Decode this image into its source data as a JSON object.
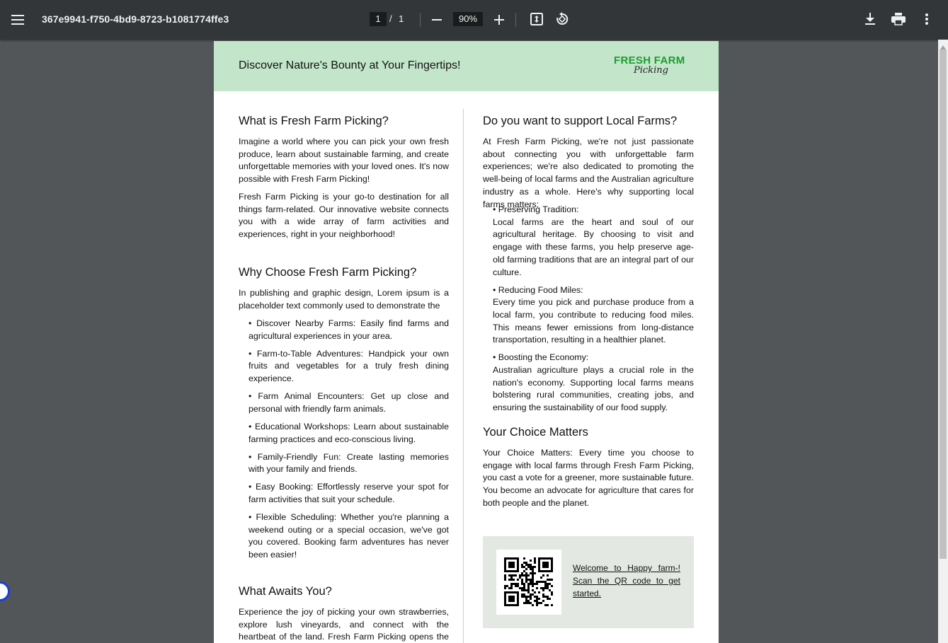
{
  "toolbar": {
    "doc_title": "367e9941-f750-4bd9-8723-b1081774ffe3",
    "current_page": "1",
    "page_separator": "/",
    "total_pages": "1",
    "zoom": "90%"
  },
  "page": {
    "banner": {
      "tagline": "Discover Nature's Bounty at Your Fingertips!",
      "logo_main": "FRESH FARM",
      "logo_script": "Picking"
    },
    "left": {
      "what_heading": "What is Fresh Farm Picking?",
      "what_p1": "Imagine a world where you can pick your own fresh produce, learn about sustainable farming, and create unforgettable memories with your loved ones. It's now possible with Fresh Farm Picking!",
      "what_p2": "Fresh Farm Picking is your go-to destination for all things farm-related. Our innovative website connects you with a wide array of farm activities and experiences, right in your neighborhood!",
      "why_heading": "Why Choose Fresh Farm Picking?",
      "why_intro": "In publishing and graphic design, Lorem ipsum is a placeholder text commonly used to demonstrate the",
      "bullets": [
        "• Discover Nearby Farms: Easily find farms and agricultural experiences in your area.",
        "• Farm-to-Table Adventures: Handpick your own fruits and vegetables for a truly fresh dining experience.",
        "• Farm Animal Encounters: Get up close and personal with friendly farm animals.",
        "• Educational Workshops: Learn about sustainable farming practices and eco-conscious living.",
        "• Family-Friendly Fun: Create lasting memories with your family and friends.",
        "• Easy Booking: Effortlessly reserve your spot for farm activities that suit your schedule.",
        "• Flexible Scheduling: Whether you're planning a weekend outing or a special occasion, we've got you covered. Booking farm adventures has never been easier!"
      ],
      "awaits_heading": "What Awaits You?",
      "awaits_p": "Experience the joy of picking your own strawberries, explore lush vineyards, and connect with the heartbeat of the land. Fresh Farm Picking opens the door to farm"
    },
    "right": {
      "support_heading": "Do you want to support Local Farms?",
      "support_intro": "At Fresh Farm Picking, we're not just passionate about connecting you with unforgettable farm experiences; we're also dedicated to promoting the well-being of local farms and the Australian agriculture industry as a whole. Here's why supporting local farms matters:",
      "points": [
        {
          "title": "• Preserving Tradition:",
          "body": "Local farms are the heart and soul of our agricultural heritage. By choosing to visit and engage with these farms, you help preserve age-old farming traditions that are an integral part of our culture."
        },
        {
          "title": "• Reducing Food Miles:",
          "body": "Every time you pick and purchase produce from a local farm, you contribute to reducing food miles. This means fewer emissions from long-distance transportation, resulting in a healthier planet."
        },
        {
          "title": "• Boosting the Economy:",
          "body": "Australian agriculture plays a crucial role in the nation's economy. Supporting local farms means bolstering rural communities, creating jobs, and ensuring the sustainability of our food supply."
        }
      ],
      "choice_heading": "Your Choice Matters",
      "choice_p": "Your Choice Matters: Every time you choose to engage with local farms through Fresh Farm Picking, you cast a vote for a greener, more sustainable future. You become an advocate for agriculture that cares for both people and the planet.",
      "qr_caption": "Welcome to Happy farm-! Scan the QR code to get started."
    }
  },
  "icons": {
    "menu": "menu-icon",
    "zoom_out": "minus-icon",
    "zoom_in": "plus-icon",
    "fit": "fit-to-page-icon",
    "rotate": "rotate-icon",
    "download": "download-icon",
    "print": "print-icon",
    "more": "more-vertical-icon"
  },
  "colors": {
    "toolbar": "#323639",
    "background": "#525659",
    "banner": "#c3e6cb",
    "logo_green": "#1c9c2f",
    "qr_panel": "#e3e8e2"
  }
}
